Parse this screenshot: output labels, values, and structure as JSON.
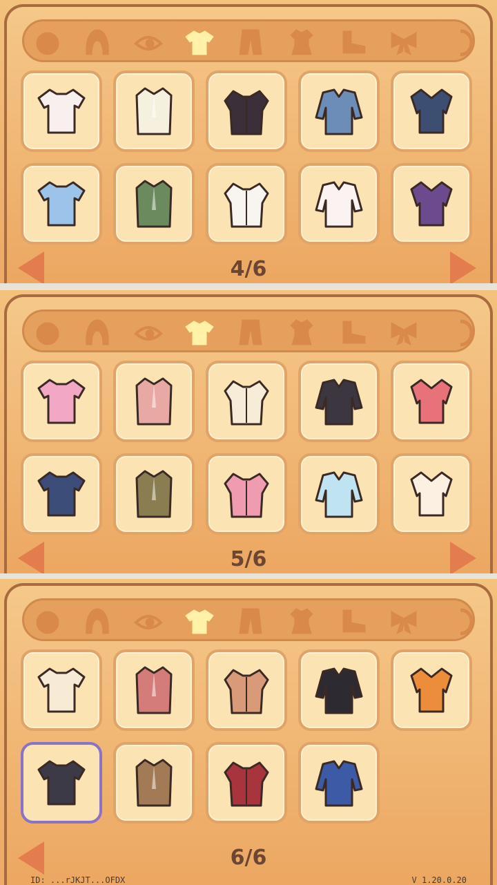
{
  "colors": {
    "panel": "#eda968",
    "card": "#fbe3b4",
    "card_border": "#e1a468",
    "selected_border": "#8a72c6",
    "tab_icon": "#d98a4b",
    "tab_active": "#fff1a8",
    "arrow": "#e47d4e",
    "pager_text": "#6b4630"
  },
  "tabs": [
    "face-tab",
    "hair-tab",
    "eye-tab",
    "top-tab",
    "bottom-tab",
    "outfit-tab",
    "shoes-tab",
    "accessory-tab",
    "more-tab"
  ],
  "active_tab": "top-tab",
  "panels": [
    {
      "page_label": "4/6",
      "items": [
        {
          "name": "white-tee-black-cat",
          "color": "#f7f0ef"
        },
        {
          "name": "cream-vest-green-tie",
          "color": "#f6f0de"
        },
        {
          "name": "black-bustier-heart",
          "color": "#3b2f3a"
        },
        {
          "name": "denim-jacket",
          "color": "#6c8db8"
        },
        {
          "name": "navy-sweater-wave",
          "color": "#3c4f72"
        },
        {
          "name": "blue-blouse",
          "color": "#9cc4ea"
        },
        {
          "name": "green-apron-dress",
          "color": "#6b8a5e"
        },
        {
          "name": "sailor-blouse-red-tie",
          "color": "#f8f4f0"
        },
        {
          "name": "off-shoulder-white-top",
          "color": "#fbf3f2"
        },
        {
          "name": "purple-hoodie",
          "color": "#6c4a8d"
        }
      ]
    },
    {
      "page_label": "5/6",
      "items": [
        {
          "name": "pink-blouse",
          "color": "#f2a7c4"
        },
        {
          "name": "pink-layered-dress",
          "color": "#e8a9a4"
        },
        {
          "name": "cream-tee-ribbon",
          "color": "#f7ecd8"
        },
        {
          "name": "black-tee-bunny",
          "color": "#3b3640"
        },
        {
          "name": "watermelon-crop-top",
          "color": "#e8727a"
        },
        {
          "name": "navy-vest-blue-sleeves",
          "color": "#3b4d78"
        },
        {
          "name": "khaki-utility-jacket",
          "color": "#8b7d52"
        },
        {
          "name": "pink-vest-belt",
          "color": "#ef9bb0"
        },
        {
          "name": "light-blue-shrug",
          "color": "#bfe3f1"
        },
        {
          "name": "cream-shirt-blue-sleeves",
          "color": "#fbf0e2"
        }
      ]
    },
    {
      "page_label": "6/6",
      "items": [
        {
          "name": "yellow-sleeve-blouse-tie",
          "color": "#f7ebd6"
        },
        {
          "name": "red-fair-isle-cardigan",
          "color": "#d47c7a"
        },
        {
          "name": "brown-sweater",
          "color": "#d89a78"
        },
        {
          "name": "black-cropped-cardigan",
          "color": "#2e2a32"
        },
        {
          "name": "orange-bomber-jacket",
          "color": "#ec8d3c"
        },
        {
          "name": "dark-blazer",
          "color": "#3d3a48"
        },
        {
          "name": "brown-blazer",
          "color": "#a27a55"
        },
        {
          "name": "red-varsity-jacket",
          "color": "#a8343e"
        },
        {
          "name": "blue-varsity-jacket",
          "color": "#3d5aa6"
        }
      ],
      "selected_index": 5
    }
  ],
  "footer": {
    "left": "ID: ...rJKJT...OFDX",
    "right": "V 1.20.0.20"
  }
}
